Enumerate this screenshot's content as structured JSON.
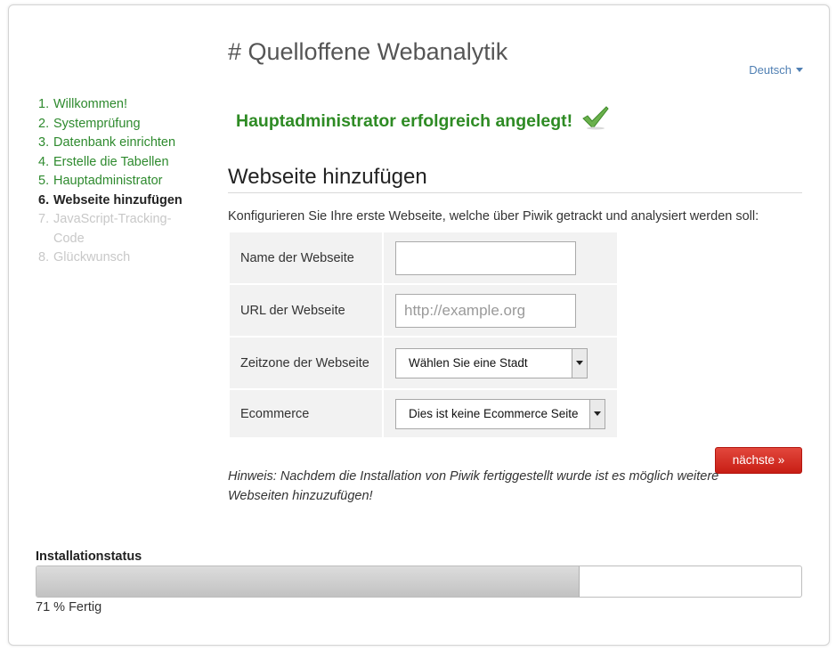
{
  "header": {
    "title": "# Quelloffene Webanalytik",
    "language": "Deutsch"
  },
  "steps": [
    {
      "num": "1.",
      "label": "Willkommen!",
      "state": "done"
    },
    {
      "num": "2.",
      "label": "Systemprüfung",
      "state": "done"
    },
    {
      "num": "3.",
      "label": "Datenbank einrichten",
      "state": "done"
    },
    {
      "num": "4.",
      "label": "Erstelle die Tabellen",
      "state": "done"
    },
    {
      "num": "5.",
      "label": "Hauptadministrator",
      "state": "done"
    },
    {
      "num": "6.",
      "label": "Webseite hinzufügen",
      "state": "current"
    },
    {
      "num": "7.",
      "label": "JavaScript-Tracking-Code",
      "state": "future"
    },
    {
      "num": "8.",
      "label": "Glückwunsch",
      "state": "future"
    }
  ],
  "main": {
    "success_message": "Hauptadministrator erfolgreich angelegt!",
    "section_title": "Webseite hinzufügen",
    "intro": "Konfigurieren Sie Ihre erste Webseite, welche über Piwik getrackt und analysiert werden soll:",
    "form": {
      "name_label": "Name der Webseite",
      "name_value": "",
      "url_label": "URL der Webseite",
      "url_placeholder": "http://example.org",
      "timezone_label": "Zeitzone der Webseite",
      "timezone_selected": "Wählen Sie eine Stadt",
      "ecommerce_label": "Ecommerce",
      "ecommerce_selected": "Dies ist keine Ecommerce Seite"
    },
    "note": "Hinweis: Nachdem die Installation von Piwik fertiggestellt wurde ist es möglich weitere Webseiten hinzuzufügen!",
    "next_button": "nächste »"
  },
  "status": {
    "title": "Installationstatus",
    "progress_percent": 71,
    "progress_text": "71 % Fertig"
  },
  "colors": {
    "done_step": "#2e8a2e",
    "future_step": "#c8c8c8",
    "success": "#2e8b24",
    "button": "#d4291f",
    "link": "#4f7fb3"
  },
  "icons": {
    "success": "checkmark-icon",
    "language_caret": "caret-down-icon",
    "select_arrow": "chevron-down-icon"
  }
}
